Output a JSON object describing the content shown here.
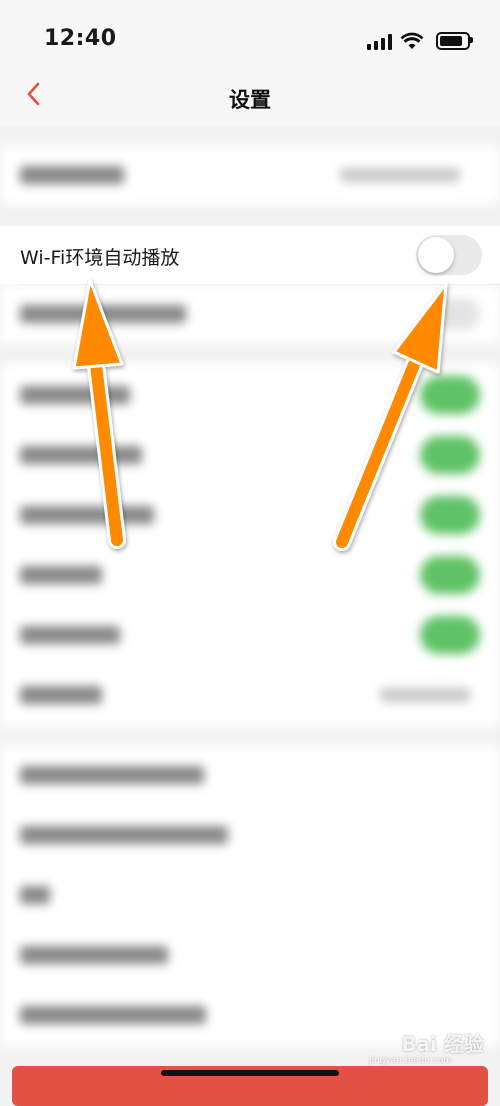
{
  "status_bar": {
    "time": "12:40",
    "signal_icon": "signal-bars-icon",
    "wifi_icon": "wifi-icon",
    "battery_icon": "battery-icon"
  },
  "nav": {
    "back_icon": "chevron-left-icon",
    "title": "设置",
    "accent_color": "#e15245"
  },
  "settings": {
    "wifi_autoplay": {
      "label": "Wi-Fi环境自动播放",
      "enabled": false
    }
  },
  "watermark": {
    "text": "Bai 经验",
    "subtext": "jingyan.baidu.com"
  },
  "colors": {
    "toggle_on": "#5fc266",
    "toggle_off": "#e9e9ea",
    "arrow": "#ff8a00"
  }
}
